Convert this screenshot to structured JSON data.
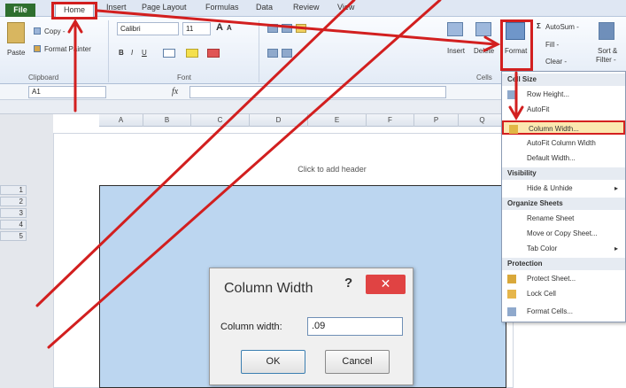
{
  "ribbon_tabs": {
    "file": "File",
    "home": "Home",
    "insert": "Insert",
    "page_layout": "Page Layout",
    "formulas": "Formulas",
    "data": "Data",
    "review": "Review",
    "view": "View"
  },
  "clipboard": {
    "paste": "Paste",
    "copy": "Copy -",
    "format_painter": "Format Painter",
    "group": "Clipboard"
  },
  "font": {
    "name": "Calibri",
    "size": "11",
    "group": "Font",
    "grow": "A",
    "shrink": "A",
    "bold": "B",
    "italic": "I",
    "underline": "U"
  },
  "cells": {
    "insert": "Insert",
    "delete": "Delete",
    "format": "Format",
    "group": "Cells"
  },
  "editing": {
    "autosum": "AutoSum -",
    "fill": "Fill -",
    "clear": "Clear -",
    "sort_filter_1": "Sort &",
    "sort_filter_2": "Filter -"
  },
  "formula_bar": {
    "cell_ref": "A1",
    "fx": "fx"
  },
  "columns": [
    "A",
    "B",
    "C",
    "D",
    "E",
    "F",
    "P",
    "Q"
  ],
  "rows": [
    "1",
    "2",
    "3",
    "4",
    "5"
  ],
  "page": {
    "header_placeholder": "Click to add header"
  },
  "format_menu": {
    "cell_size_header": "Cell Size",
    "row_height": "Row Height...",
    "autofit_row": "AutoFit",
    "column_width": "Column Width...",
    "autofit_column": "AutoFit Column Width",
    "default_width": "Default Width...",
    "visibility_header": "Visibility",
    "hide_unhide": "Hide & Unhide",
    "organize_header": "Organize Sheets",
    "rename_sheet": "Rename Sheet",
    "move_copy": "Move or Copy Sheet...",
    "tab_color": "Tab Color",
    "protection_header": "Protection",
    "protect_sheet": "Protect Sheet...",
    "lock_cell": "Lock Cell",
    "format_cells": "Format Cells..."
  },
  "dialog": {
    "title": "Column Width",
    "help": "?",
    "close": "✕",
    "label": "Column width:",
    "value": ".09",
    "ok": "OK",
    "cancel": "Cancel"
  },
  "colors": {
    "annotation": "#d21f1f",
    "selection": "#bcd6f0",
    "file_tab": "#2f6f2f"
  }
}
